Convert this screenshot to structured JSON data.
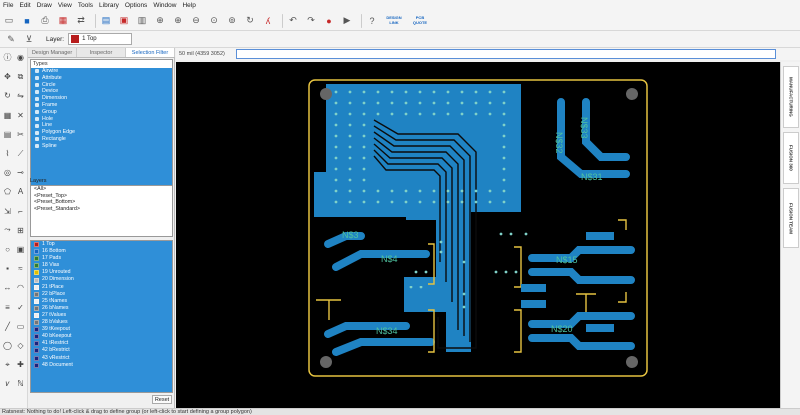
{
  "menu": [
    "File",
    "Edit",
    "Draw",
    "View",
    "Tools",
    "Library",
    "Options",
    "Window",
    "Help"
  ],
  "toolbar": {
    "design_link": "DESIGN LINK",
    "pcb_quote": "PCB QUOTE"
  },
  "layer_bar": {
    "label": "Layer:",
    "selected": "1 Top",
    "selected_color": "#b71c1c"
  },
  "panel": {
    "tabs": [
      "Design Manager",
      "Inspector",
      "Selection Filter"
    ],
    "types_header": "Types",
    "types": [
      "Airwire",
      "Attribute",
      "Circle",
      "Device",
      "Dimension",
      "Frame",
      "Group",
      "Hole",
      "Line",
      "Polygon Edge",
      "Rectangle",
      "Spline"
    ],
    "layers_header": "Layers",
    "presets": [
      "<All>",
      "<Preset_Top>",
      "<Preset_Bottom>",
      "<Preset_Standard>"
    ],
    "layers": [
      {
        "name": "1 Top",
        "color": "#b71c1c"
      },
      {
        "name": "16 Bottom",
        "color": "#1565c0"
      },
      {
        "name": "17 Pads",
        "color": "#2e7d32"
      },
      {
        "name": "18 Vias",
        "color": "#2e7d32"
      },
      {
        "name": "19 Unrouted",
        "color": "#e0c000"
      },
      {
        "name": "20 Dimension",
        "color": "#bdbdbd"
      },
      {
        "name": "21 tPlace",
        "color": "#eeeeee"
      },
      {
        "name": "22 bPlace",
        "color": "#757575"
      },
      {
        "name": "25 tNames",
        "color": "#eeeeee"
      },
      {
        "name": "26 bNames",
        "color": "#757575"
      },
      {
        "name": "27 tValues",
        "color": "#eeeeee"
      },
      {
        "name": "28 bValues",
        "color": "#757575"
      },
      {
        "name": "39 tKeepout",
        "color": "#1a237e"
      },
      {
        "name": "40 bKeepout",
        "color": "#1a237e"
      },
      {
        "name": "41 tRestrict",
        "color": "#1a237e"
      },
      {
        "name": "42 bRestrict",
        "color": "#1a237e"
      },
      {
        "name": "43 vRestrict",
        "color": "#1a237e"
      },
      {
        "name": "48 Document",
        "color": "#1a237e"
      }
    ],
    "reset": "Reset"
  },
  "command": {
    "coordinate": "50 mil (4359 3052)",
    "value": ""
  },
  "canvas": {
    "labels": [
      "N$3",
      "N$4",
      "N$34",
      "N$31",
      "N$32",
      "N$33",
      "N$15",
      "N$20"
    ]
  },
  "side_tabs": [
    "MANUFACTURING",
    "FUSION 360",
    "FUSION TEAM"
  ],
  "status": "Ratsnest: Nothing to do! Left-click & drag to define group (or left-click to start defining a group polygon)",
  "colors": {
    "accent": "#2f8fd8",
    "board_outline": "#e6c341",
    "copper_bottom": "#1f83c3",
    "via": "#7fd1c8",
    "trace_dark": "#0b0b0b"
  }
}
